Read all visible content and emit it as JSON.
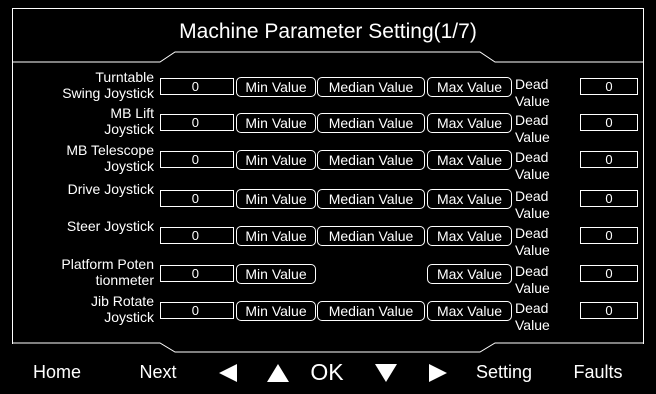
{
  "title": "Machine Parameter Setting(1/7)",
  "rows": [
    {
      "label": "Turntable\nSwing Joystick",
      "value": "0",
      "min": "Min Value",
      "median": "Median Value",
      "max": "Max Value",
      "dead_label": "Dead\nValue",
      "dead_value": "0"
    },
    {
      "label": "MB Lift\nJoystick",
      "value": "0",
      "min": "Min Value",
      "median": "Median Value",
      "max": "Max Value",
      "dead_label": "Dead\nValue",
      "dead_value": "0"
    },
    {
      "label": "MB Telescope\nJoystick",
      "value": "0",
      "min": "Min Value",
      "median": "Median Value",
      "max": "Max Value",
      "dead_label": "Dead\nValue",
      "dead_value": "0"
    },
    {
      "label": "Drive Joystick",
      "value": "0",
      "min": "Min Value",
      "median": "Median Value",
      "max": "Max Value",
      "dead_label": "Dead\nValue",
      "dead_value": "0"
    },
    {
      "label": "Steer Joystick",
      "value": "0",
      "min": "Min Value",
      "median": "Median Value",
      "max": "Max Value",
      "dead_label": "Dead\nValue",
      "dead_value": "0"
    },
    {
      "label": "Platform Poten\ntionmeter",
      "value": "0",
      "min": "Min Value",
      "median": "",
      "max": "Max Value",
      "dead_label": "Dead\nValue",
      "dead_value": "0"
    },
    {
      "label": "Jib Rotate\nJoystick",
      "value": "0",
      "min": "Min Value",
      "median": "Median Value",
      "max": "Max Value",
      "dead_label": "Dead\nValue",
      "dead_value": "0"
    }
  ],
  "nav": {
    "home": "Home",
    "next": "Next",
    "left_icon": "left-triangle",
    "up_icon": "up-triangle",
    "ok": "OK",
    "down_icon": "down-triangle",
    "right_icon": "right-triangle",
    "setting": "Setting",
    "faults": "Faults"
  },
  "colors": {
    "background": "#000000",
    "foreground": "#ffffff"
  }
}
